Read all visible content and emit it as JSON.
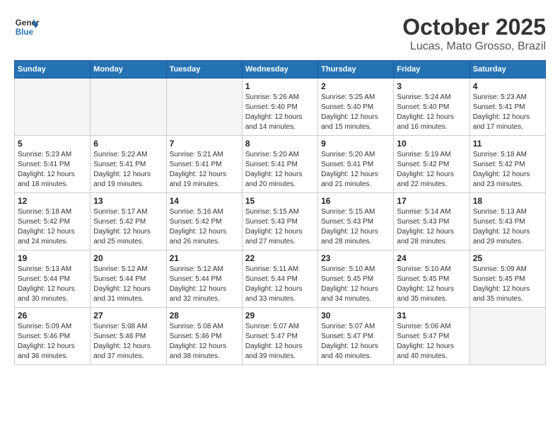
{
  "header": {
    "logo_line1": "General",
    "logo_line2": "Blue",
    "month": "October 2025",
    "location": "Lucas, Mato Grosso, Brazil"
  },
  "weekdays": [
    "Sunday",
    "Monday",
    "Tuesday",
    "Wednesday",
    "Thursday",
    "Friday",
    "Saturday"
  ],
  "weeks": [
    [
      {
        "day": "",
        "info": ""
      },
      {
        "day": "",
        "info": ""
      },
      {
        "day": "",
        "info": ""
      },
      {
        "day": "1",
        "info": "Sunrise: 5:26 AM\nSunset: 5:40 PM\nDaylight: 12 hours\nand 14 minutes."
      },
      {
        "day": "2",
        "info": "Sunrise: 5:25 AM\nSunset: 5:40 PM\nDaylight: 12 hours\nand 15 minutes."
      },
      {
        "day": "3",
        "info": "Sunrise: 5:24 AM\nSunset: 5:40 PM\nDaylight: 12 hours\nand 16 minutes."
      },
      {
        "day": "4",
        "info": "Sunrise: 5:23 AM\nSunset: 5:41 PM\nDaylight: 12 hours\nand 17 minutes."
      }
    ],
    [
      {
        "day": "5",
        "info": "Sunrise: 5:23 AM\nSunset: 5:41 PM\nDaylight: 12 hours\nand 18 minutes."
      },
      {
        "day": "6",
        "info": "Sunrise: 5:22 AM\nSunset: 5:41 PM\nDaylight: 12 hours\nand 19 minutes."
      },
      {
        "day": "7",
        "info": "Sunrise: 5:21 AM\nSunset: 5:41 PM\nDaylight: 12 hours\nand 19 minutes."
      },
      {
        "day": "8",
        "info": "Sunrise: 5:20 AM\nSunset: 5:41 PM\nDaylight: 12 hours\nand 20 minutes."
      },
      {
        "day": "9",
        "info": "Sunrise: 5:20 AM\nSunset: 5:41 PM\nDaylight: 12 hours\nand 21 minutes."
      },
      {
        "day": "10",
        "info": "Sunrise: 5:19 AM\nSunset: 5:42 PM\nDaylight: 12 hours\nand 22 minutes."
      },
      {
        "day": "11",
        "info": "Sunrise: 5:18 AM\nSunset: 5:42 PM\nDaylight: 12 hours\nand 23 minutes."
      }
    ],
    [
      {
        "day": "12",
        "info": "Sunrise: 5:18 AM\nSunset: 5:42 PM\nDaylight: 12 hours\nand 24 minutes."
      },
      {
        "day": "13",
        "info": "Sunrise: 5:17 AM\nSunset: 5:42 PM\nDaylight: 12 hours\nand 25 minutes."
      },
      {
        "day": "14",
        "info": "Sunrise: 5:16 AM\nSunset: 5:42 PM\nDaylight: 12 hours\nand 26 minutes."
      },
      {
        "day": "15",
        "info": "Sunrise: 5:15 AM\nSunset: 5:43 PM\nDaylight: 12 hours\nand 27 minutes."
      },
      {
        "day": "16",
        "info": "Sunrise: 5:15 AM\nSunset: 5:43 PM\nDaylight: 12 hours\nand 28 minutes."
      },
      {
        "day": "17",
        "info": "Sunrise: 5:14 AM\nSunset: 5:43 PM\nDaylight: 12 hours\nand 28 minutes."
      },
      {
        "day": "18",
        "info": "Sunrise: 5:13 AM\nSunset: 5:43 PM\nDaylight: 12 hours\nand 29 minutes."
      }
    ],
    [
      {
        "day": "19",
        "info": "Sunrise: 5:13 AM\nSunset: 5:44 PM\nDaylight: 12 hours\nand 30 minutes."
      },
      {
        "day": "20",
        "info": "Sunrise: 5:12 AM\nSunset: 5:44 PM\nDaylight: 12 hours\nand 31 minutes."
      },
      {
        "day": "21",
        "info": "Sunrise: 5:12 AM\nSunset: 5:44 PM\nDaylight: 12 hours\nand 32 minutes."
      },
      {
        "day": "22",
        "info": "Sunrise: 5:11 AM\nSunset: 5:44 PM\nDaylight: 12 hours\nand 33 minutes."
      },
      {
        "day": "23",
        "info": "Sunrise: 5:10 AM\nSunset: 5:45 PM\nDaylight: 12 hours\nand 34 minutes."
      },
      {
        "day": "24",
        "info": "Sunrise: 5:10 AM\nSunset: 5:45 PM\nDaylight: 12 hours\nand 35 minutes."
      },
      {
        "day": "25",
        "info": "Sunrise: 5:09 AM\nSunset: 5:45 PM\nDaylight: 12 hours\nand 35 minutes."
      }
    ],
    [
      {
        "day": "26",
        "info": "Sunrise: 5:09 AM\nSunset: 5:46 PM\nDaylight: 12 hours\nand 36 minutes."
      },
      {
        "day": "27",
        "info": "Sunrise: 5:08 AM\nSunset: 5:46 PM\nDaylight: 12 hours\nand 37 minutes."
      },
      {
        "day": "28",
        "info": "Sunrise: 5:08 AM\nSunset: 5:46 PM\nDaylight: 12 hours\nand 38 minutes."
      },
      {
        "day": "29",
        "info": "Sunrise: 5:07 AM\nSunset: 5:47 PM\nDaylight: 12 hours\nand 39 minutes."
      },
      {
        "day": "30",
        "info": "Sunrise: 5:07 AM\nSunset: 5:47 PM\nDaylight: 12 hours\nand 40 minutes."
      },
      {
        "day": "31",
        "info": "Sunrise: 5:06 AM\nSunset: 5:47 PM\nDaylight: 12 hours\nand 40 minutes."
      },
      {
        "day": "",
        "info": ""
      }
    ]
  ]
}
